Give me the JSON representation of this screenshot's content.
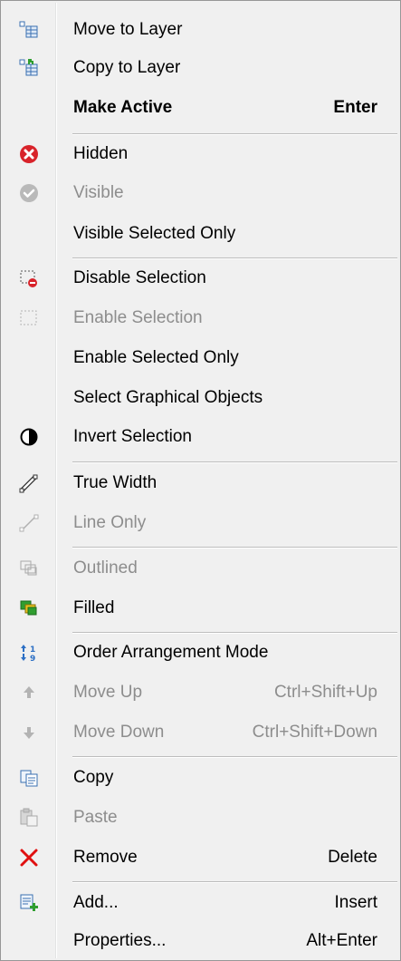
{
  "menu": {
    "items": [
      {
        "key": "move_to_layer",
        "label": "Move to Layer",
        "shortcut": "",
        "icon": "move-to-layer-icon",
        "disabled": false,
        "bold": false
      },
      {
        "key": "copy_to_layer",
        "label": "Copy to Layer",
        "shortcut": "",
        "icon": "copy-to-layer-icon",
        "disabled": false,
        "bold": false
      },
      {
        "key": "make_active",
        "label": "Make Active",
        "shortcut": "Enter",
        "icon": "",
        "disabled": false,
        "bold": true
      },
      {
        "key": "hidden",
        "label": "Hidden",
        "shortcut": "",
        "icon": "hidden-icon",
        "disabled": false,
        "bold": false
      },
      {
        "key": "visible",
        "label": "Visible",
        "shortcut": "",
        "icon": "visible-icon",
        "disabled": true,
        "bold": false
      },
      {
        "key": "visible_selected_only",
        "label": "Visible Selected Only",
        "shortcut": "",
        "icon": "",
        "disabled": false,
        "bold": false
      },
      {
        "key": "disable_selection",
        "label": "Disable Selection",
        "shortcut": "",
        "icon": "disable-selection-icon",
        "disabled": false,
        "bold": false
      },
      {
        "key": "enable_selection",
        "label": "Enable Selection",
        "shortcut": "",
        "icon": "enable-selection-icon",
        "disabled": true,
        "bold": false
      },
      {
        "key": "enable_selected_only",
        "label": "Enable Selected Only",
        "shortcut": "",
        "icon": "",
        "disabled": false,
        "bold": false
      },
      {
        "key": "select_graphical_objects",
        "label": "Select Graphical Objects",
        "shortcut": "",
        "icon": "",
        "disabled": false,
        "bold": false
      },
      {
        "key": "invert_selection",
        "label": "Invert Selection",
        "shortcut": "",
        "icon": "invert-selection-icon",
        "disabled": false,
        "bold": false
      },
      {
        "key": "true_width",
        "label": "True Width",
        "shortcut": "",
        "icon": "true-width-icon",
        "disabled": false,
        "bold": false
      },
      {
        "key": "line_only",
        "label": "Line Only",
        "shortcut": "",
        "icon": "line-only-icon",
        "disabled": true,
        "bold": false
      },
      {
        "key": "outlined",
        "label": "Outlined",
        "shortcut": "",
        "icon": "outlined-icon",
        "disabled": true,
        "bold": false
      },
      {
        "key": "filled",
        "label": "Filled",
        "shortcut": "",
        "icon": "filled-icon",
        "disabled": false,
        "bold": false
      },
      {
        "key": "order_arrangement_mode",
        "label": "Order Arrangement Mode",
        "shortcut": "",
        "icon": "order-arrangement-icon",
        "disabled": false,
        "bold": false
      },
      {
        "key": "move_up",
        "label": "Move Up",
        "shortcut": "Ctrl+Shift+Up",
        "icon": "move-up-icon",
        "disabled": true,
        "bold": false
      },
      {
        "key": "move_down",
        "label": "Move Down",
        "shortcut": "Ctrl+Shift+Down",
        "icon": "move-down-icon",
        "disabled": true,
        "bold": false
      },
      {
        "key": "copy",
        "label": "Copy",
        "shortcut": "",
        "icon": "copy-icon",
        "disabled": false,
        "bold": false
      },
      {
        "key": "paste",
        "label": "Paste",
        "shortcut": "",
        "icon": "paste-icon",
        "disabled": true,
        "bold": false
      },
      {
        "key": "remove",
        "label": "Remove",
        "shortcut": "Delete",
        "icon": "remove-icon",
        "disabled": false,
        "bold": false
      },
      {
        "key": "add",
        "label": "Add...",
        "shortcut": "Insert",
        "icon": "add-icon",
        "disabled": false,
        "bold": false
      },
      {
        "key": "properties",
        "label": "Properties...",
        "shortcut": "Alt+Enter",
        "icon": "",
        "disabled": false,
        "bold": false
      }
    ]
  },
  "colors": {
    "menu_background": "#f0f0f0",
    "disabled_text": "#8d8d8d",
    "separator": "#bdbdbd",
    "hidden_red": "#d8232a",
    "remove_red": "#e01010",
    "filled_green": "#2f9e2f",
    "filled_yellow": "#e8c11c"
  }
}
